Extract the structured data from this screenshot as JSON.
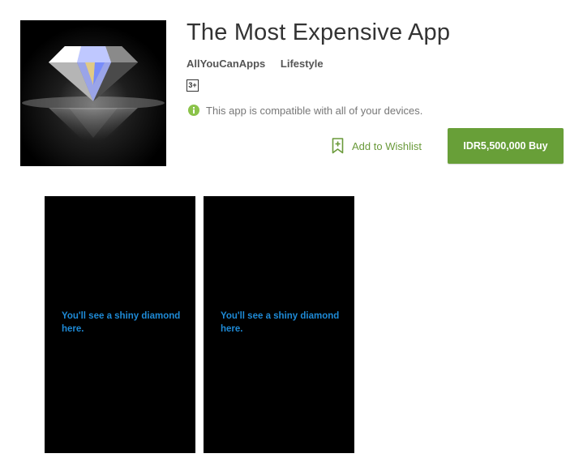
{
  "app": {
    "title": "The Most Expensive App",
    "developer": "AllYouCanApps",
    "category": "Lifestyle",
    "content_rating": "3+",
    "compatibility_text": "This app is compatible with all of your devices.",
    "icon": "diamond-image"
  },
  "actions": {
    "wishlist_label": "Add to Wishlist",
    "wishlist_icon": "bookmark-plus-icon",
    "buy_label": "IDR5,500,000 Buy"
  },
  "screenshots": [
    {
      "caption": "You'll see a shiny diamond here."
    },
    {
      "caption": "You'll see a shiny diamond here."
    }
  ],
  "colors": {
    "buy_button": "#689f38",
    "wishlist_text": "#6a9a3a",
    "info_icon": "#8bc34a",
    "screenshot_text": "#1e8ad6"
  }
}
